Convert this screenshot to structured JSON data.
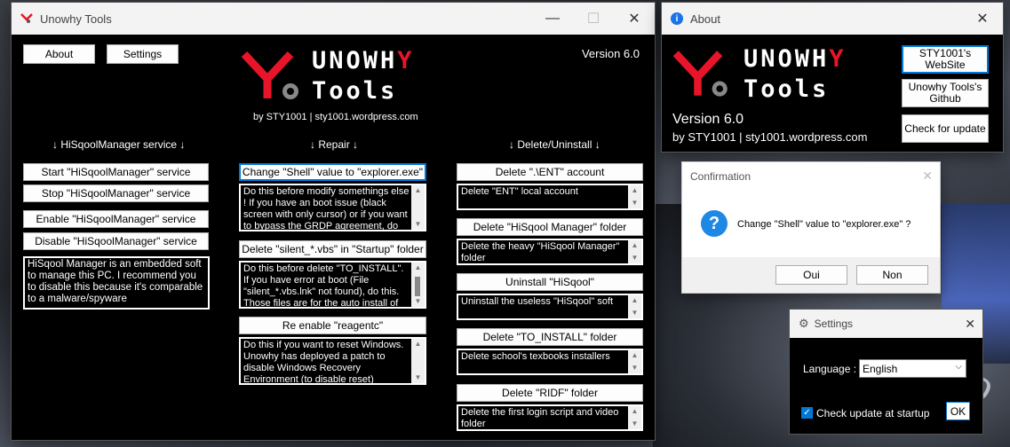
{
  "main": {
    "title": "Unowhy Tools",
    "about_button": "About",
    "settings_button": "Settings",
    "version": "Version 6.0",
    "logo_unowh": "UNOWH",
    "logo_y": "Y",
    "logo_tools": "Tools",
    "byline": "by STY1001 | sty1001.wordpress.com",
    "col_service": "↓ HiSqoolManager service ↓",
    "col_repair": "↓ Repair ↓",
    "col_delete": "↓ Delete/Uninstall ↓",
    "service": {
      "start": "Start \"HiSqoolManager\" service",
      "stop": "Stop \"HiSqoolManager\" service",
      "enable": "Enable \"HiSqoolManager\" service",
      "disable": "Disable \"HiSqoolManager\" service",
      "info": "HiSqool Manager is an embedded soft to manage this PC. I recommend you to disable this because it's comparable to a malware/spyware"
    },
    "repair": [
      {
        "button": "Change \"Shell\" value to \"explorer.exe\"",
        "desc": "Do this before modify somethings else ! If you have an boot issue (black screen with only cursor) or if you want to bypass the GRDP agreement, do this"
      },
      {
        "button": "Delete \"silent_*.vbs\" in \"Startup\" folder",
        "desc": "Do this before delete \"TO_INSTALL\". If you have error at boot (File \"silent_*.vbs.lnk\" not found), do this. Those files are for the auto install of"
      },
      {
        "button": "Re enable \"reagentc\"",
        "desc": "Do this if you want to reset Windows. Unowhy has deployed a patch to disable Windows Recovery Environment (to disable reset)"
      }
    ],
    "delete": [
      {
        "button": "Delete \".\\ENT\" account",
        "desc": "Delete \"ENT\" local account"
      },
      {
        "button": "Delete \"HiSqool Manager\" folder",
        "desc": "Delete the heavy \"HiSqool Manager\" folder"
      },
      {
        "button": "Uninstall \"HiSqool\"",
        "desc": "Uninstall the useless \"HiSqool\" soft"
      },
      {
        "button": "Delete \"TO_INSTALL\" folder",
        "desc": "Delete school's texbooks installers"
      },
      {
        "button": "Delete \"RIDF\" folder",
        "desc": "Delete the first login script and video folder"
      }
    ]
  },
  "about": {
    "title": "About",
    "version": "Version 6.0",
    "byline": "by STY1001 | sty1001.wordpress.com",
    "website_button": "STY1001's WebSite",
    "github_button": "Unowhy Tools's Github",
    "update_button": "Check for update"
  },
  "confirm": {
    "title": "Confirmation",
    "message": "Change \"Shell\" value to \"explorer.exe\" ?",
    "yes": "Oui",
    "no": "Non"
  },
  "settings": {
    "title": "Settings",
    "language_label": "Language :",
    "language_value": "English",
    "check_update": "Check update at startup",
    "check_update_checked": true,
    "ok": "OK"
  },
  "colors": {
    "brand_red": "#e8152a",
    "accent": "#0078d7"
  }
}
